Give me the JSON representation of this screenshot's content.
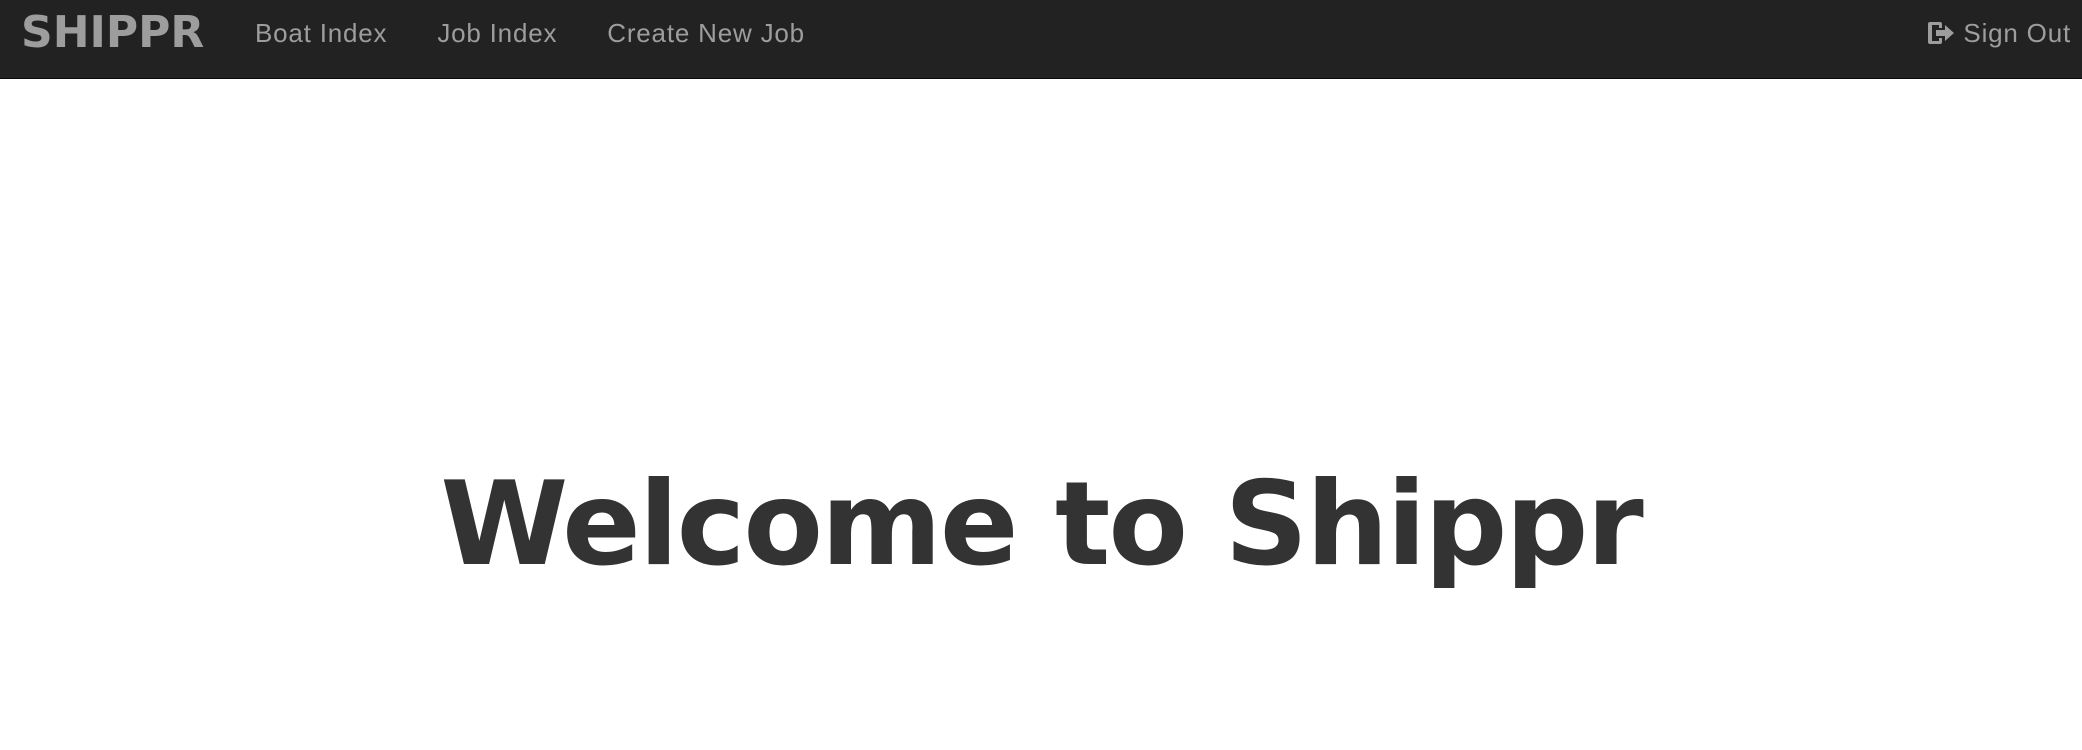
{
  "navbar": {
    "brand": "SHIPPR",
    "links": [
      {
        "label": "Boat Index"
      },
      {
        "label": "Job Index"
      },
      {
        "label": "Create New Job"
      }
    ],
    "signout": {
      "icon": "sign-out-icon",
      "label": "Sign Out"
    }
  },
  "main": {
    "title": "Welcome to Shippr"
  },
  "colors": {
    "navbar_bg": "#222222",
    "nav_text": "#9d9d9d",
    "title_text": "#333333",
    "page_bg": "#ffffff"
  }
}
